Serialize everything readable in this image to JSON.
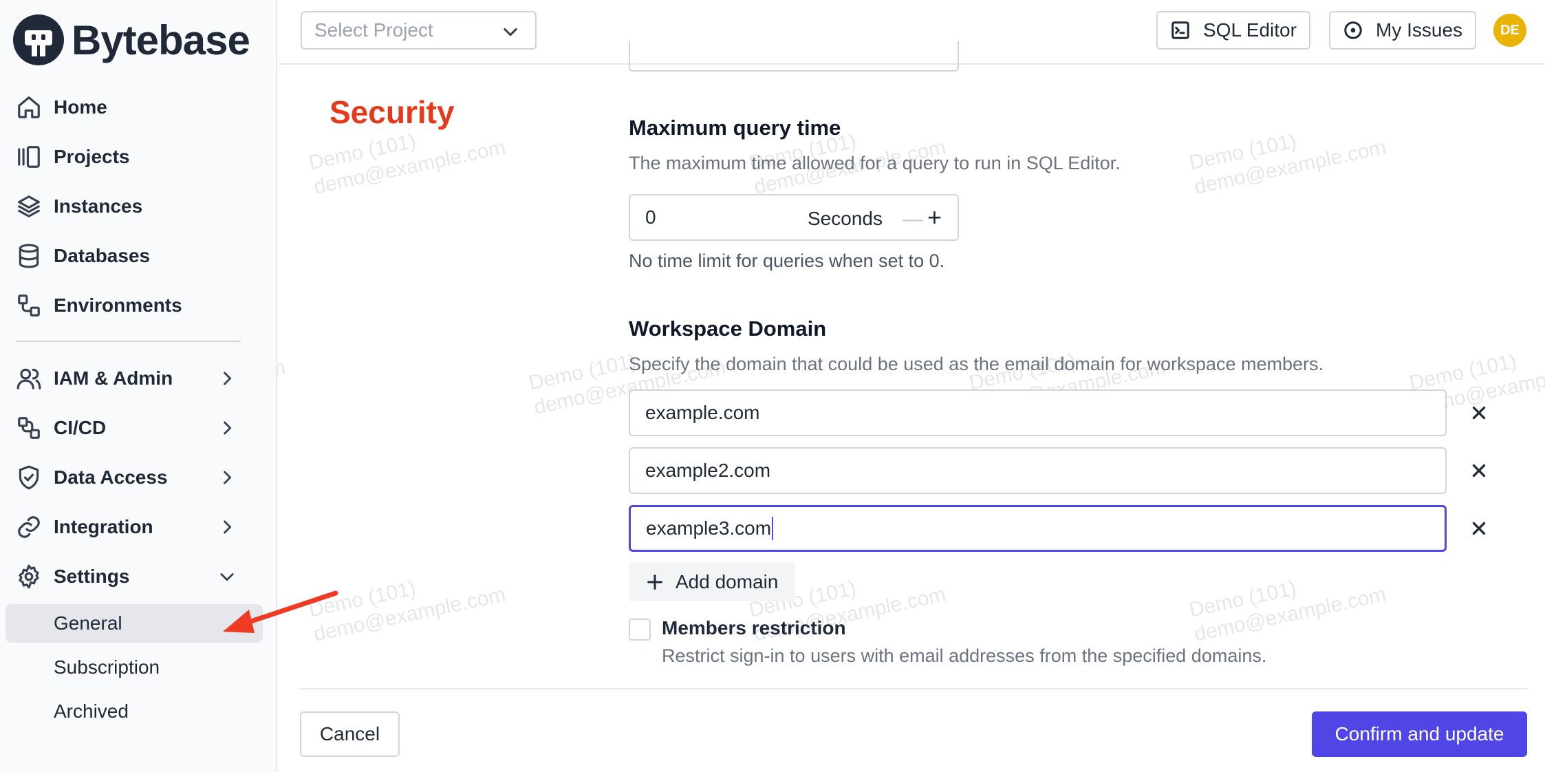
{
  "app": {
    "brand": "Bytebase"
  },
  "sidebar": {
    "items": [
      {
        "label": "Home",
        "icon": "home-icon"
      },
      {
        "label": "Projects",
        "icon": "projects-icon"
      },
      {
        "label": "Instances",
        "icon": "layers-icon"
      },
      {
        "label": "Databases",
        "icon": "database-icon"
      },
      {
        "label": "Environments",
        "icon": "environments-icon"
      }
    ],
    "groups": [
      {
        "label": "IAM & Admin",
        "icon": "users-icon",
        "expanded": false
      },
      {
        "label": "CI/CD",
        "icon": "cicd-icon",
        "expanded": false
      },
      {
        "label": "Data Access",
        "icon": "shield-icon",
        "expanded": false
      },
      {
        "label": "Integration",
        "icon": "link-icon",
        "expanded": false
      },
      {
        "label": "Settings",
        "icon": "gear-icon",
        "expanded": true
      }
    ],
    "settings_sub": [
      {
        "label": "General",
        "active": true
      },
      {
        "label": "Subscription",
        "active": false
      },
      {
        "label": "Archived",
        "active": false
      }
    ]
  },
  "header": {
    "project_select_placeholder": "Select Project",
    "sql_editor_label": "SQL Editor",
    "my_issues_label": "My Issues",
    "avatar_initials": "DE"
  },
  "main": {
    "section_title": "Security",
    "max_query": {
      "label": "Maximum query time",
      "description": "The maximum time allowed for a query to run in SQL Editor.",
      "value": "0",
      "unit": "Seconds",
      "note": "No time limit for queries when set to 0."
    },
    "workspace_domain": {
      "label": "Workspace Domain",
      "description": "Specify the domain that could be used as the email domain for workspace members.",
      "domains": [
        "example.com",
        "example2.com",
        "example3.com"
      ],
      "add_label": "Add domain"
    },
    "members_restriction": {
      "label": "Members restriction",
      "description": "Restrict sign-in to users with email addresses from the specified domains.",
      "checked": false
    }
  },
  "footer": {
    "cancel_label": "Cancel",
    "confirm_label": "Confirm and update"
  },
  "watermark": {
    "line1": "Demo (101)",
    "line2": "demo@example.com"
  },
  "colors": {
    "accent": "#4f46e5",
    "section_title": "#e5391c",
    "avatar": "#eab308",
    "annotation_arrow": "#ef3b24"
  }
}
